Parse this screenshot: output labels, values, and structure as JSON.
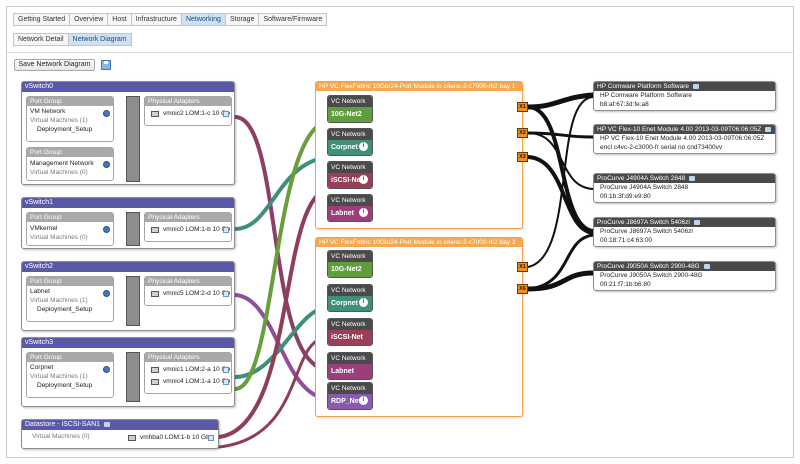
{
  "tabs": [
    "Getting Started",
    "Overview",
    "Host",
    "Infrastructure",
    "Networking",
    "Storage",
    "Software/Firmware"
  ],
  "active_tab": "Networking",
  "subtabs": [
    "Network Detail",
    "Network Diagram"
  ],
  "active_subtab": "Network Diagram",
  "toolbar": {
    "save_label": "Save Network Diagram",
    "save_icon": "save-disk-icon"
  },
  "vswitches": [
    {
      "title": "vSwitch0",
      "port_groups": [
        {
          "header": "Port Group",
          "name": "VM Network",
          "vms": "Virtual Machines (1)",
          "sub": "Deployment_Setup"
        },
        {
          "header": "Port Group",
          "name": "Management Network",
          "vms": "Virtual Machines (0)",
          "sub": ""
        }
      ],
      "adapters_header": "Physical Adapters",
      "adapters": [
        "vmnic2 LOM:1-c 10 Gb"
      ]
    },
    {
      "title": "vSwitch1",
      "port_groups": [
        {
          "header": "Port Group",
          "name": "VMkernel",
          "vms": "Virtual Machines (0)",
          "sub": ""
        }
      ],
      "adapters_header": "Physical Adapters",
      "adapters": [
        "vmnic0 LOM:1-b 10 Gb"
      ]
    },
    {
      "title": "vSwitch2",
      "port_groups": [
        {
          "header": "Port Group",
          "name": "Labnet",
          "vms": "Virtual Machines (1)",
          "sub": "Deployment_Setup"
        }
      ],
      "adapters_header": "Physical Adapters",
      "adapters": [
        "vmnic5 LOM:2-d 10 Gb"
      ]
    },
    {
      "title": "vSwitch3",
      "port_groups": [
        {
          "header": "Port Group",
          "name": "Corpnet",
          "vms": "Virtual Machines (1)",
          "sub": "Deployment_Setup"
        }
      ],
      "adapters_header": "Physical Adapters",
      "adapters": [
        "vmnic1 LOM:2-a 10 Gb",
        "vmnic4 LOM:1-a 10 Gb"
      ]
    }
  ],
  "datastore": {
    "title": "Datastore - iSCSI-SAN1",
    "vms": "Virtual Machines (0)",
    "adapter": "vmhba0 LOM:1-b 10 Gb"
  },
  "modules": [
    {
      "title": "HP VC FlexFabric 10Gb/24-Port Module in c4enc-2-c7000-rk2 bay 1",
      "networks": [
        {
          "header": "VC Network",
          "name": "10G-Net2",
          "color": "#5e9e3c"
        },
        {
          "header": "VC Network",
          "name": "Corpnet",
          "color": "#3f8f7a"
        },
        {
          "header": "VC Network",
          "name": "iSCSI-Net",
          "color": "#9a3f58"
        },
        {
          "header": "VC Network",
          "name": "Labnet",
          "color": "#9a3f7a"
        }
      ],
      "ports": [
        "X1",
        "X2",
        "X3"
      ]
    },
    {
      "title": "HP VC FlexFabric 10Gb/24-Port Module in c4enc-2-c7000-rk2 bay 2",
      "networks": [
        {
          "header": "VC Network",
          "name": "10G-Net2",
          "color": "#5e9e3c"
        },
        {
          "header": "VC Network",
          "name": "Corpnet",
          "color": "#3f8f7a"
        },
        {
          "header": "VC Network",
          "name": "iSCSI-Net",
          "color": "#9a3f58"
        },
        {
          "header": "VC Network",
          "name": "Labnet",
          "color": "#9a3f7a"
        },
        {
          "header": "VC Network",
          "name": "RDP_Net",
          "color": "#8a5ab0"
        }
      ],
      "ports": [
        "X1",
        "X6"
      ]
    }
  ],
  "external_devices": [
    {
      "title": "HP Comware Platform Software",
      "lines": [
        "HP Comware Platform Software",
        "b8:af:67:3d:fe:a8"
      ]
    },
    {
      "title": "HP VC Flex-10 Enet Module 4.00 2013-03-09T06:06:05Z",
      "lines": [
        "HP VC Flex-10 Enet Module 4.00 2013-03-09T06:06:05Z",
        "encl c4vc-2-c3000-fr serial no cnd73400vv"
      ]
    },
    {
      "title": "ProCurve J4904A Switch 2848",
      "lines": [
        "ProCurve J4904A Switch 2848",
        "00:1b:3f:d9:e9:80"
      ]
    },
    {
      "title": "ProCurve J8697A Switch 5406zl",
      "lines": [
        "ProCurve J8697A Switch 5406zl",
        "00:18:71:c4:63:00"
      ]
    },
    {
      "title": "ProCurve J9050A Switch 2900-48G",
      "lines": [
        "ProCurve J9050A Switch 2900-48G",
        "00:21:f7:1b:b6:80"
      ]
    }
  ],
  "colors": {
    "vswitch_header": "#5a59a8",
    "module_header": "#f5a84f",
    "port": "#ef8f1f",
    "tab_active": "#cfe1f2"
  }
}
